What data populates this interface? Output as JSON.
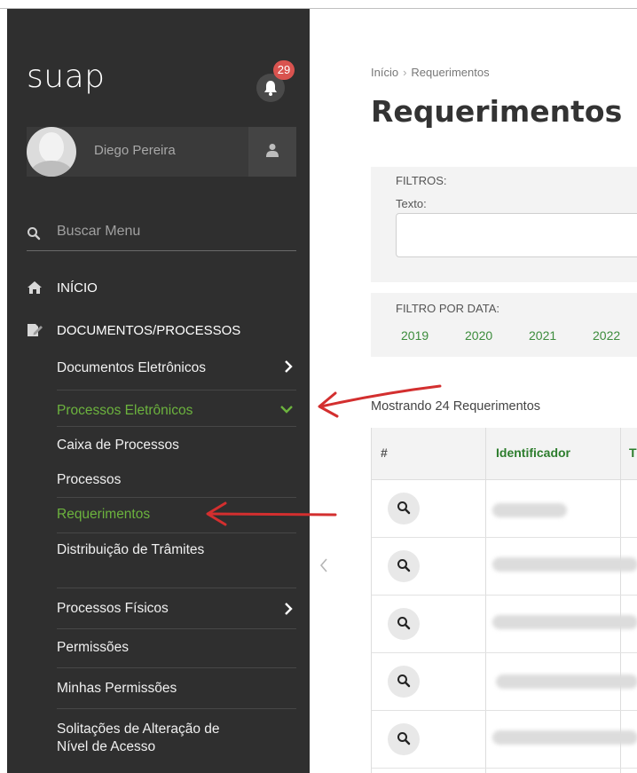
{
  "app": {
    "logo": "suap",
    "notifications": "29"
  },
  "user": {
    "name": "Diego Pereira"
  },
  "search": {
    "placeholder": "Buscar Menu"
  },
  "sidebar": {
    "sections": [
      {
        "label": "INÍCIO"
      },
      {
        "label": "DOCUMENTOS/PROCESSOS"
      }
    ],
    "items": [
      {
        "label": "Documentos Eletrônicos"
      },
      {
        "label": "Processos Eletrônicos"
      },
      {
        "label": "Caixa de Processos"
      },
      {
        "label": "Processos"
      },
      {
        "label": "Requerimentos"
      },
      {
        "label": "Distribuição de Trâmites"
      },
      {
        "label": "Processos Físicos"
      },
      {
        "label": "Permissões"
      },
      {
        "label": "Minhas Permissões"
      },
      {
        "label": "Solitações de Alteração de"
      },
      {
        "label": "Nível de Acesso"
      }
    ]
  },
  "breadcrumb": {
    "home": "Início",
    "current": "Requerimentos"
  },
  "page": {
    "title": "Requerimentos"
  },
  "filters": {
    "label": "FILTROS:",
    "text_label": "Texto:"
  },
  "date_filter": {
    "label": "FILTRO POR DATA:",
    "years": [
      "2019",
      "2020",
      "2021",
      "2022"
    ]
  },
  "results": {
    "count_text": "Mostrando 24 Requerimentos"
  },
  "table": {
    "columns": [
      "#",
      "Identificador",
      "T"
    ]
  },
  "colors": {
    "sidebar_bg": "#2f2f2f",
    "accent_green": "#6cb33e",
    "badge_red": "#d9534f",
    "annotation_red": "#d32f2f"
  }
}
